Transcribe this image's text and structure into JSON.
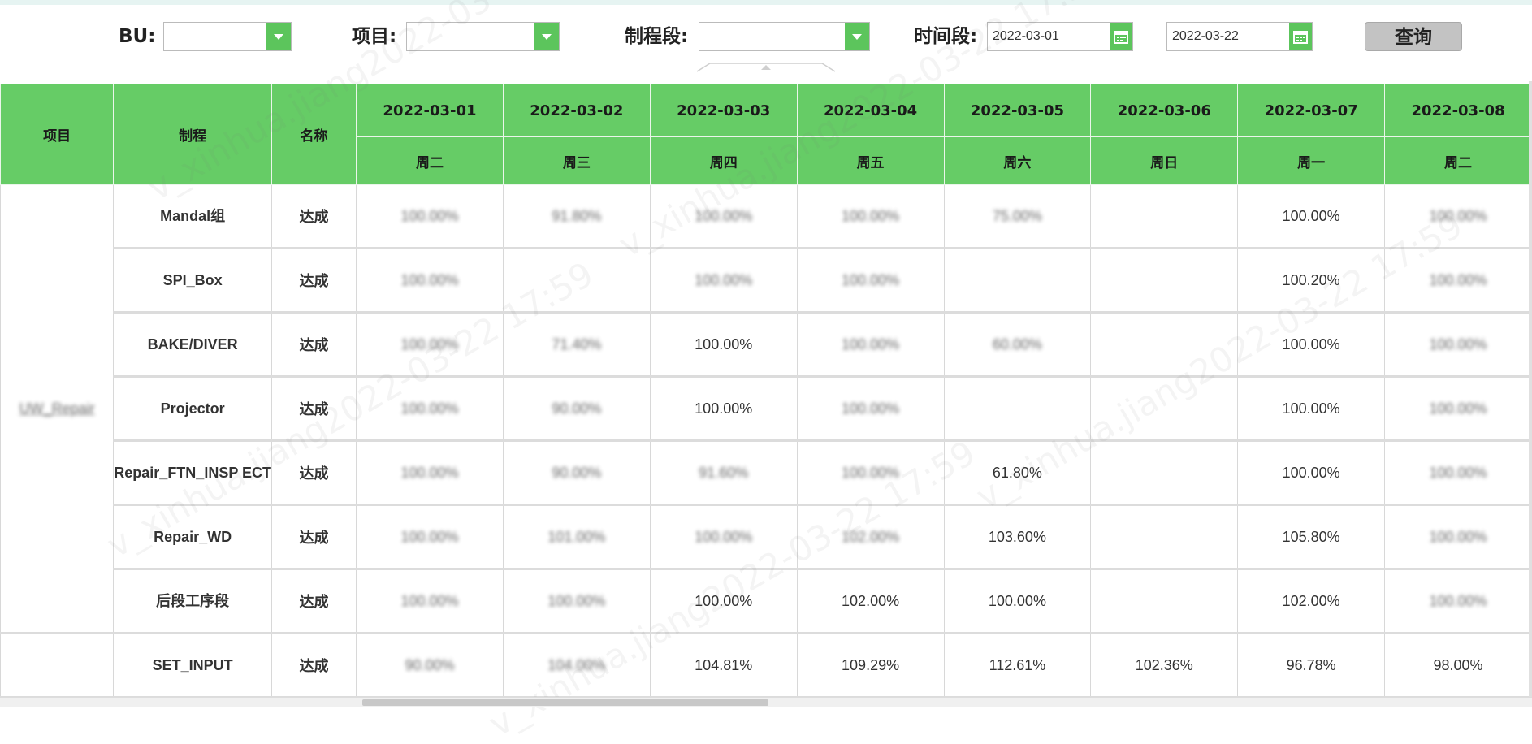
{
  "filters": {
    "bu_label": "BU:",
    "project_label": "项目:",
    "process_label": "制程段:",
    "period_label": "时间段:",
    "start_date": "2022-03-01",
    "end_date": "2022-03-22",
    "query_label": "查询"
  },
  "table": {
    "col_project": "项目",
    "col_process": "制程",
    "col_name": "名称",
    "dates": [
      "2022-03-01",
      "2022-03-02",
      "2022-03-03",
      "2022-03-04",
      "2022-03-05",
      "2022-03-06",
      "2022-03-07",
      "2022-03-08"
    ],
    "weekdays": [
      "周二",
      "周三",
      "周四",
      "周五",
      "周六",
      "周日",
      "周一",
      "周二"
    ],
    "project_value": "UW_Repair",
    "rows": [
      {
        "process": "Mandal组",
        "name": "达成",
        "cells": [
          "100.00%",
          "91.80%",
          "100.00%",
          "100.00%",
          "75.00%",
          "",
          "100.00%",
          "100.00%"
        ]
      },
      {
        "process": "SPI_Box",
        "name": "达成",
        "cells": [
          "100.00%",
          "",
          "100.00%",
          "100.00%",
          "",
          "",
          "100.20%",
          "100.00%"
        ]
      },
      {
        "process": "BAKE/DIVER",
        "name": "达成",
        "cells": [
          "100.00%",
          "71.40%",
          "100.00%",
          "100.00%",
          "60.00%",
          "",
          "100.00%",
          "100.00%"
        ]
      },
      {
        "process": "Projector",
        "name": "达成",
        "cells": [
          "100.00%",
          "90.00%",
          "100.00%",
          "100.00%",
          "",
          "",
          "100.00%",
          "100.00%"
        ]
      },
      {
        "process": "Repair_FTN_INSP ECT",
        "name": "达成",
        "cells": [
          "100.00%",
          "90.00%",
          "91.60%",
          "100.00%",
          "61.80%",
          "",
          "100.00%",
          "100.00%"
        ]
      },
      {
        "process": "Repair_WD",
        "name": "达成",
        "cells": [
          "100.00%",
          "101.00%",
          "100.00%",
          "102.00%",
          "103.60%",
          "",
          "105.80%",
          "100.00%"
        ]
      },
      {
        "process": "后段工序段",
        "name": "达成",
        "cells": [
          "100.00%",
          "100.00%",
          "100.00%",
          "102.00%",
          "100.00%",
          "",
          "102.00%",
          "100.00%"
        ]
      },
      {
        "process": "SET_INPUT",
        "name": "达成",
        "cells": [
          "90.00%",
          "104.00%",
          "104.81%",
          "109.29%",
          "112.61%",
          "102.36%",
          "96.78%",
          "98.00%"
        ]
      }
    ]
  },
  "colors": {
    "header_green": "#66cc66",
    "alert_red": "#e8262c",
    "link_blue": "#2b3cff"
  },
  "watermark": "v_xinhua.jiang2022-03-22 17:59"
}
